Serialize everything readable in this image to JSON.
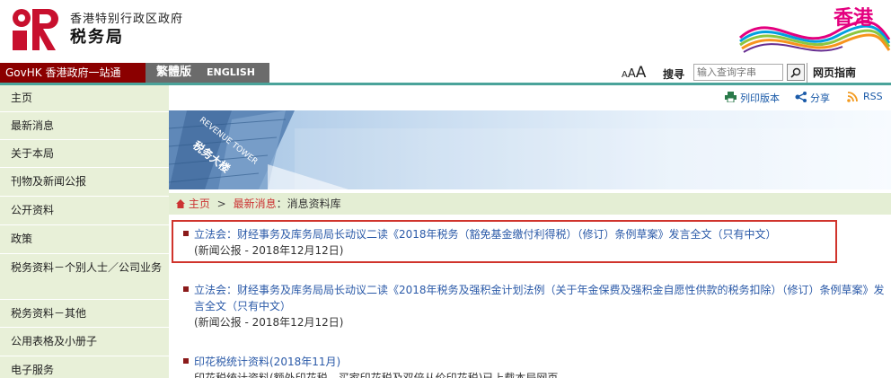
{
  "header": {
    "dept_top": "香港特别行政区政府",
    "dept_name": "税务局",
    "brand": "香港"
  },
  "topbar": {
    "govhk": "GovHK 香港政府一站通",
    "lang_trad": "繁體版",
    "lang_eng": "ENGLISH",
    "font_small": "A",
    "font_medium": "A",
    "font_large": "A",
    "search_label": "搜寻",
    "search_placeholder": "输入查询字串",
    "sitemap": "网页指南"
  },
  "sidebar": {
    "items": [
      {
        "label": "主页"
      },
      {
        "label": "最新消息"
      },
      {
        "label": "关于本局"
      },
      {
        "label": "刊物及新闻公报"
      },
      {
        "label": "公开资料"
      },
      {
        "label": "政策"
      },
      {
        "label": "税务资料－个别人士／公司业务"
      },
      {
        "label": "税务资料－其他"
      },
      {
        "label": "公用表格及小册子"
      },
      {
        "label": "电子服务"
      }
    ]
  },
  "toolbar": {
    "print": "列印版本",
    "share": "分享",
    "rss": "RSS"
  },
  "banner": {
    "sign1": "REVENUE TOWER",
    "sign2": "税务大楼"
  },
  "breadcrumb": {
    "home": "主页",
    "sep": ">",
    "news": "最新消息",
    "lib": "消息资料库"
  },
  "news": [
    {
      "title": "立法会：财经事务及库务局局长动议二读《2018年税务（豁免基金缴付利得税）（修订）条例草案》发言全文（只有中文）",
      "meta": "(新闻公报 - 2018年12月12日)"
    },
    {
      "title": "立法会：财经事务及库务局局长动议二读《2018年税务及强积金计划法例（关于年金保费及强积金自愿性供款的税务扣除）（修订）条例草案》发言全文（只有中文）",
      "meta": "(新闻公报 - 2018年12月12日)"
    },
    {
      "title": "印花税统计资料(2018年11月)",
      "meta": "印花税统计资料(额外印花税，买家印花税及双倍从价印花税)已上载本局网页。"
    }
  ],
  "colors": {
    "govhk_red": "#8b0000",
    "sidebar_bg": "#e8f0d8",
    "link_blue": "#2b5aa8",
    "highlight_red": "#d0342c",
    "brand_pink": "#e4007f"
  }
}
